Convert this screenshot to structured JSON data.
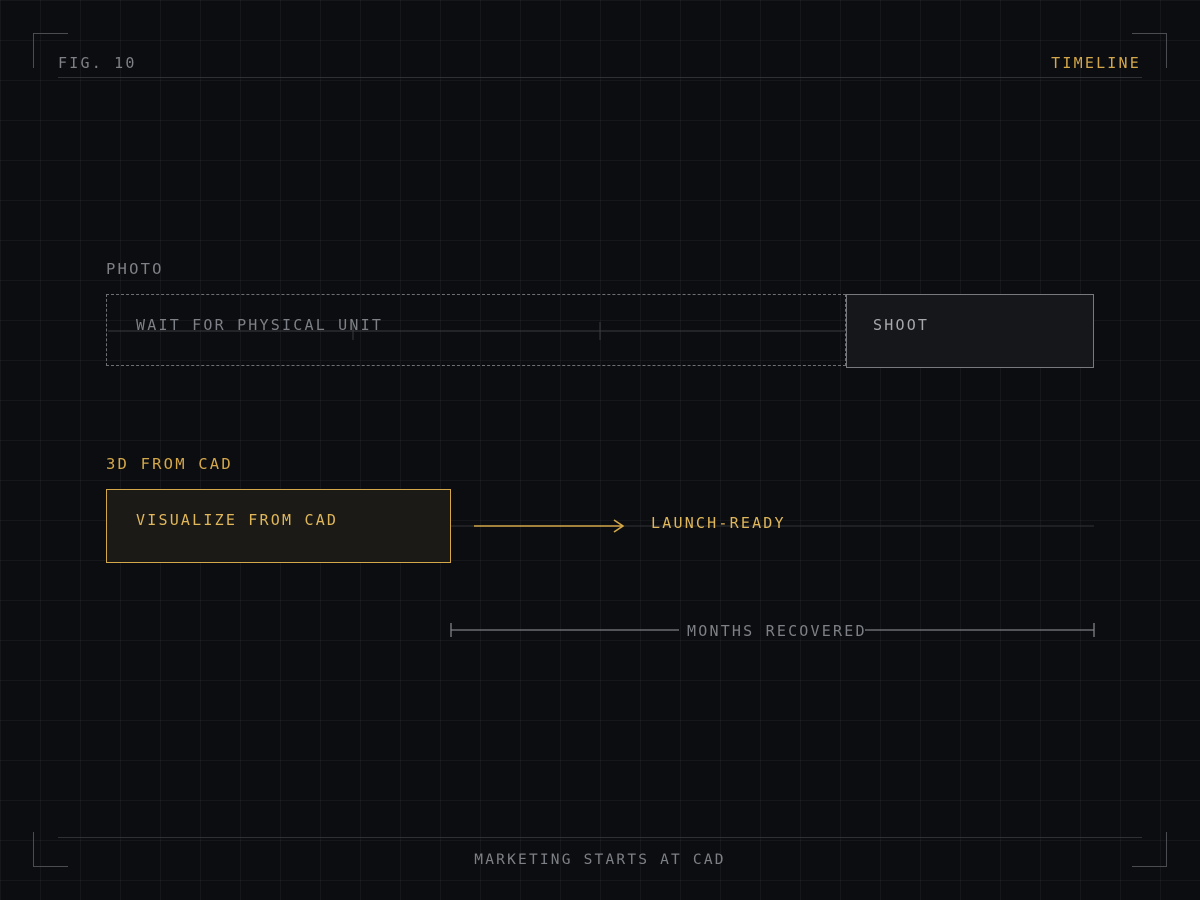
{
  "figure": {
    "number_label": "FIG. 10",
    "tag": "TIMELINE"
  },
  "photo_track": {
    "label": "PHOTO",
    "wait_step": "WAIT FOR PHYSICAL UNIT",
    "shoot_step": "SHOOT"
  },
  "cad_track": {
    "label": "3D FROM CAD",
    "step": "VISUALIZE FROM CAD",
    "outcome": "LAUNCH-READY"
  },
  "span": {
    "label": "MONTHS RECOVERED"
  },
  "caption": "MARKETING STARTS AT CAD",
  "colors": {
    "background": "#0c0d10",
    "accent": "#d4a84a",
    "muted_text": "#7d8086",
    "line": "#2e3035"
  }
}
